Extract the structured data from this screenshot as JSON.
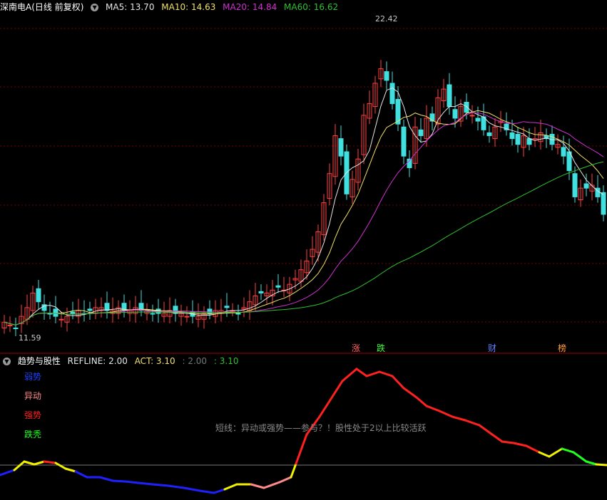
{
  "header": {
    "stock_name": "深南电A(日线 前复权)",
    "ma5_label": "MA5: 13.70",
    "ma10_label": "MA10: 14.63",
    "ma20_label": "MA20: 14.84",
    "ma60_label": "MA60: 16.62"
  },
  "price_markers": {
    "high": "22.42",
    "low": "11.59"
  },
  "events": {
    "e1": "涨",
    "e2": "跌",
    "e3": "财",
    "e4": "榜"
  },
  "indicator": {
    "title": "趋势与股性",
    "refline": "REFLINE: 2.00",
    "act": "ACT: 3.10",
    "v3": ": 2.00",
    "v4": ": 3.10",
    "legend": [
      "弱势",
      "异动",
      "强势",
      "跌秃"
    ],
    "note": "短线：异动或强势——参与？！股性处于2以上比较活跃"
  },
  "colors": {
    "ma5": "#e6e6e6",
    "ma10": "#f0e068",
    "ma20": "#d030d0",
    "ma60": "#30c030",
    "up": "#ff4040",
    "down": "#40e0e0",
    "weak": "#2020ff",
    "abnormal": "#ff8a8a",
    "strong": "#ff2020",
    "falling": "#20ff20",
    "neutral": "#f0f000"
  },
  "chart_data": {
    "type": "candlestick",
    "price_high": 22.42,
    "price_low": 11.59,
    "ma_latest": {
      "MA5": 13.7,
      "MA10": 14.63,
      "MA20": 14.84,
      "MA60": 16.62
    },
    "indicator_latest": {
      "REFLINE": 2.0,
      "ACT": 3.1
    }
  }
}
